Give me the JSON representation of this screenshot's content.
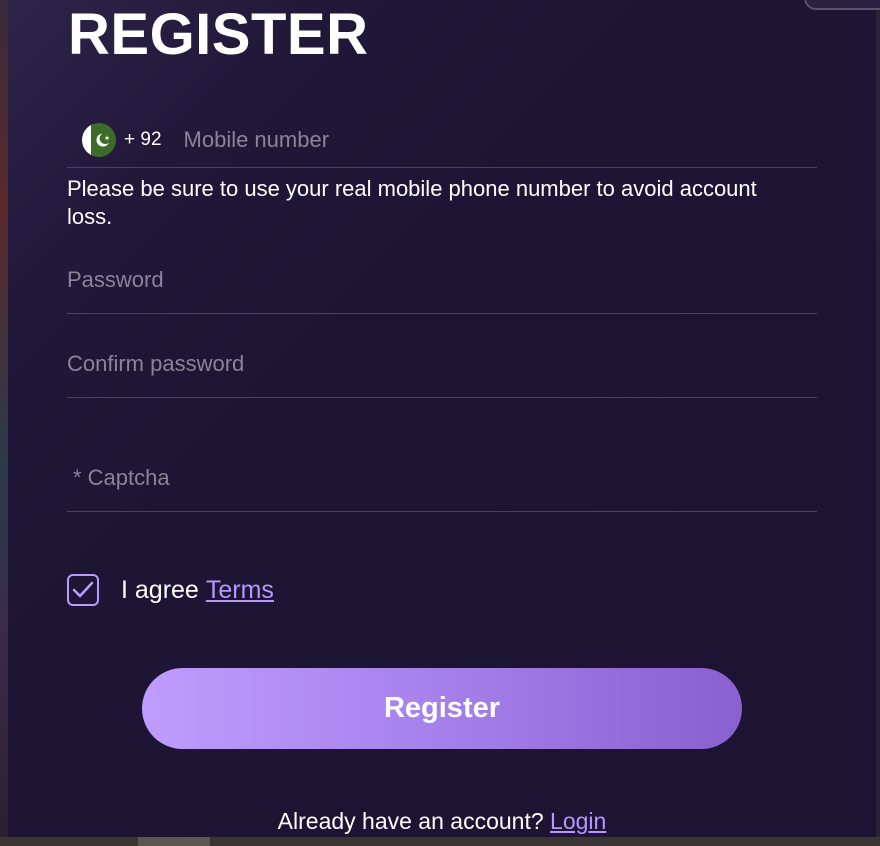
{
  "form": {
    "title": "REGISTER",
    "phone": {
      "country_code": "+ 92",
      "flag_icon": "pakistan-flag-icon",
      "placeholder": "Mobile number",
      "value": ""
    },
    "hint": "Please be sure to use your real mobile phone number to avoid account loss.",
    "password": {
      "placeholder": "Password",
      "value": ""
    },
    "confirm_password": {
      "placeholder": "Confirm password",
      "value": ""
    },
    "captcha": {
      "placeholder": "* Captcha",
      "value": ""
    },
    "agree": {
      "checked": true,
      "label": "I agree",
      "terms_link": "Terms"
    },
    "register_button": "Register",
    "login": {
      "prompt": "Already have an account?",
      "link": "Login"
    }
  },
  "colors": {
    "accent": "#b896ff",
    "button_start": "#c09cff",
    "button_end": "#8860cf",
    "panel_bg": "#1c1432"
  }
}
